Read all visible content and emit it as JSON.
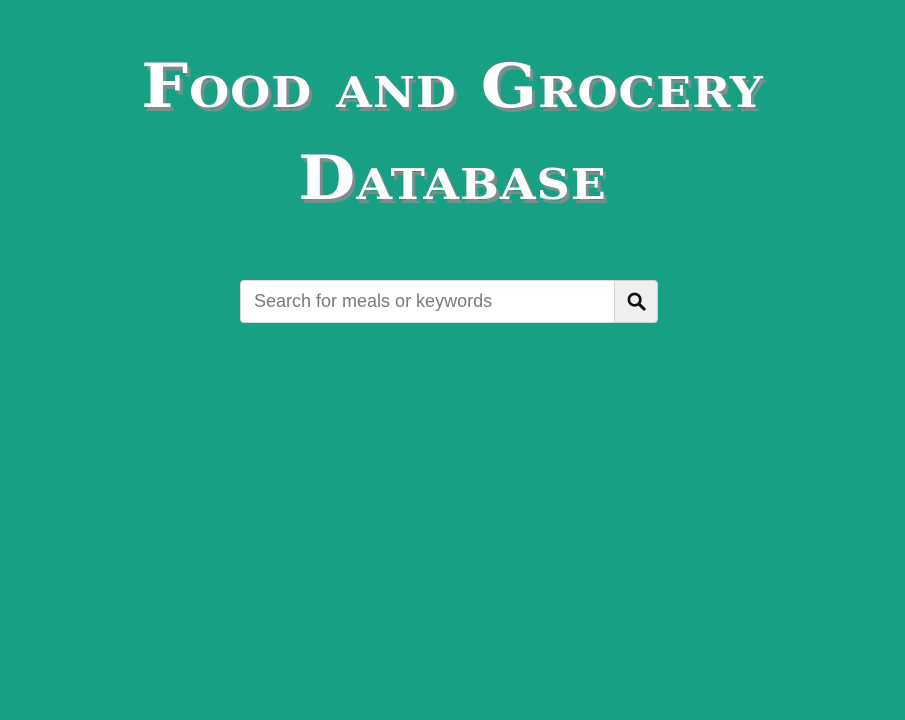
{
  "header": {
    "title_line_1": "Food and Grocery",
    "title_line_2": "Database"
  },
  "search": {
    "placeholder": "Search for meals or keywords",
    "value": "",
    "button_icon": "search-icon"
  },
  "colors": {
    "background": "#18a085",
    "title_text": "#ffffff",
    "title_shadow": "#7f8c8d",
    "button_bg": "#efefef"
  }
}
